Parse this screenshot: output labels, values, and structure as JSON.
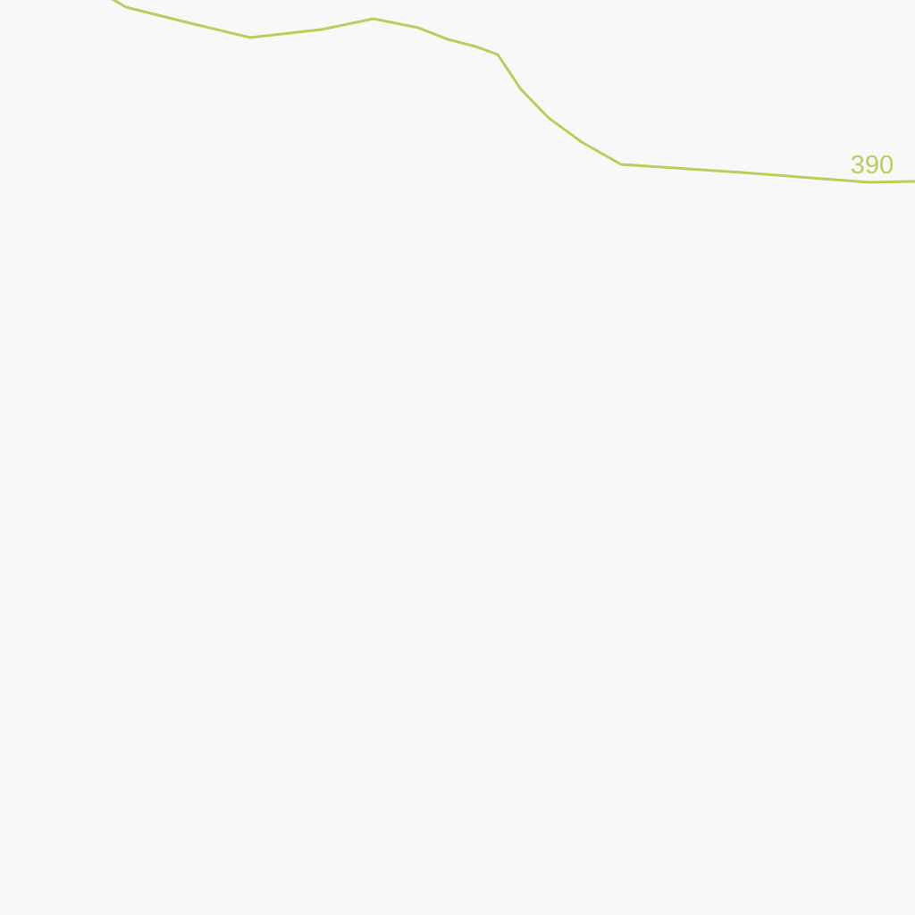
{
  "map": {
    "background_color": "#f8f8f8",
    "contour_lines": [
      {
        "elevation_label": "390",
        "color": "#b9cf5b"
      }
    ]
  }
}
